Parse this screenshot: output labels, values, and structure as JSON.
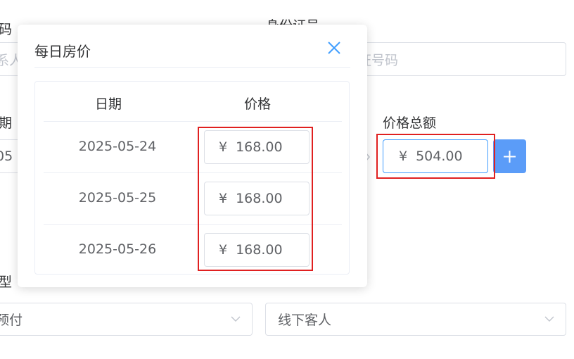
{
  "form": {
    "label_top_left": "码",
    "label_top_right": "身份证号",
    "contact_placeholder": "系人",
    "idcard_placeholder": "身份证号码",
    "label_date": "期",
    "date_value_fragment": "05",
    "label_total": "价格总额",
    "total_currency": "¥",
    "total_value": "504.00",
    "label_type": "型",
    "type_select_value": "预付",
    "guest_select_value": "线下客人"
  },
  "popover": {
    "title": "每日房价",
    "columns": {
      "date": "日期",
      "price": "价格"
    },
    "currency": "¥",
    "rows": [
      {
        "date": "2025-05-24",
        "price": "168.00"
      },
      {
        "date": "2025-05-25",
        "price": "168.00"
      },
      {
        "date": "2025-05-26",
        "price": "168.00"
      }
    ]
  },
  "colors": {
    "accent": "#409eff",
    "add_button": "#5b9cf8",
    "highlight": "#e02020"
  },
  "icons": {
    "close": "close-icon",
    "add": "plus-icon",
    "dropdown": "chevron-down-icon"
  }
}
